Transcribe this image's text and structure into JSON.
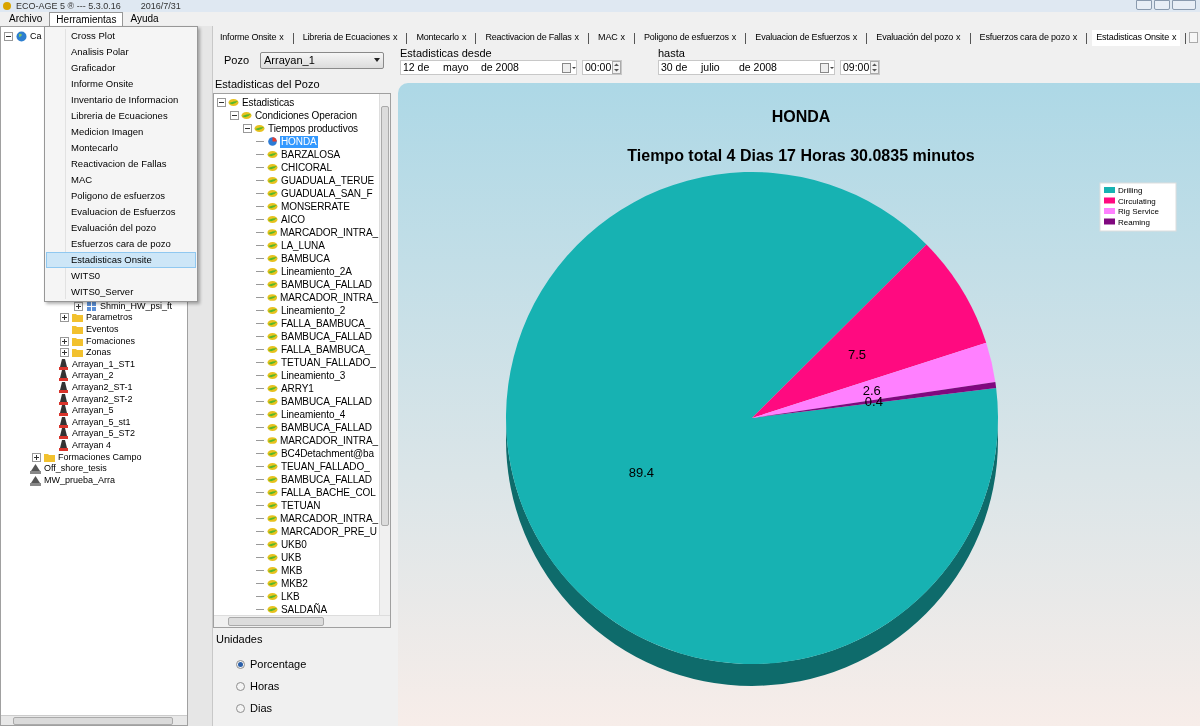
{
  "window": {
    "title": "ECO-AGE 5 ® --- 5.3.0.16",
    "date": "2016/7/31"
  },
  "menu_bar": [
    {
      "label": "Archivo",
      "selected": false
    },
    {
      "label": "Herramientas",
      "selected": true
    },
    {
      "label": "Ayuda",
      "selected": false
    }
  ],
  "open_menu": [
    {
      "label": "Cross Plot",
      "selected": false
    },
    {
      "label": "Analisis Polar",
      "selected": false
    },
    {
      "label": "Graficador",
      "selected": false
    },
    {
      "label": "Informe Onsite",
      "selected": false
    },
    {
      "label": "Inventario de Informacion",
      "selected": false
    },
    {
      "label": "Libreria de Ecuaciones",
      "selected": false
    },
    {
      "label": "Medicion Imagen",
      "selected": false
    },
    {
      "label": "Montecarlo",
      "selected": false
    },
    {
      "label": "Reactivacion de Fallas",
      "selected": false
    },
    {
      "label": "MAC",
      "selected": false
    },
    {
      "label": "Poligono de esfuerzos",
      "selected": false
    },
    {
      "label": "Evaluacion de Esfuerzos",
      "selected": false
    },
    {
      "label": "Evaluación del pozo",
      "selected": false
    },
    {
      "label": "Esfuerzos cara de pozo",
      "selected": false
    },
    {
      "label": "Estadisticas Onsite",
      "selected": true
    },
    {
      "label": "WITS0",
      "selected": false
    },
    {
      "label": "WITS0_Server",
      "selected": false
    }
  ],
  "explorer": {
    "label": "Ca",
    "kind": "globe",
    "expanded": true,
    "children": [
      {
        "children": [
          {
            "children": [
              {
                "children": [
                  {
                    "children": [
                      {
                        "label": "Shmin_HW_psi_ft",
                        "kind": "grid",
                        "expanded": false
                      }
                    ]
                  },
                  {
                    "label": "Parametros",
                    "kind": "folder",
                    "expanded": false
                  },
                  {
                    "label": "Eventos",
                    "kind": "folder"
                  },
                  {
                    "label": "Fomaciones",
                    "kind": "folder",
                    "expanded": false
                  },
                  {
                    "label": "Zonas",
                    "kind": "folder",
                    "expanded": false
                  }
                ]
              },
              {
                "label": "Arrayan_1_ST1",
                "kind": "rig"
              },
              {
                "label": "Arrayan_2",
                "kind": "rig"
              },
              {
                "label": "Arrayan2_ST-1",
                "kind": "rig"
              },
              {
                "label": "Arrayan2_ST-2",
                "kind": "rig"
              },
              {
                "label": "Arrayan_5",
                "kind": "rig"
              },
              {
                "label": "Arrayan_5_st1",
                "kind": "rig"
              },
              {
                "label": "Arrayan_5_ST2",
                "kind": "rig"
              },
              {
                "label": "Arrayan 4",
                "kind": "rig"
              }
            ]
          },
          {
            "label": "Formaciones Campo",
            "kind": "folder",
            "expanded": false
          }
        ]
      },
      {
        "label": "Off_shore_tesis",
        "kind": "platform"
      },
      {
        "label": "MW_prueba_Arra",
        "kind": "platform"
      }
    ]
  },
  "tabs": [
    {
      "label": "Informe Onsite",
      "close": "x",
      "selected": false
    },
    {
      "label": "Libreria de Ecuaciones",
      "close": "x",
      "selected": false
    },
    {
      "label": "Montecarlo",
      "close": "x",
      "selected": false
    },
    {
      "label": "Reactivacion de Fallas",
      "close": "x",
      "selected": false
    },
    {
      "label": "MAC",
      "close": "x",
      "selected": false
    },
    {
      "label": "Poligono de esfuerzos",
      "close": "x",
      "selected": false
    },
    {
      "label": "Evaluacion de Esfuerzos",
      "close": "x",
      "selected": false
    },
    {
      "label": "Evaluación del pozo",
      "close": "x",
      "selected": false
    },
    {
      "label": "Esfuerzos cara de pozo",
      "close": "x",
      "selected": false
    },
    {
      "label": "Estadisticas Onsite",
      "close": "x",
      "selected": true
    }
  ],
  "pozo": {
    "label": "Pozo",
    "value": "Arrayan_1"
  },
  "range": [
    {
      "label": "Estadisticas desde",
      "day": "12 de",
      "month": "mayo",
      "year": "de 2008",
      "time": "00:00"
    },
    {
      "label": "hasta",
      "day": "30 de",
      "month": "julio",
      "year": "de 2008",
      "time": "09:00"
    }
  ],
  "stats_tree": {
    "title": "Estadisticas del Pozo",
    "root": {
      "label": "Estadisticas",
      "expanded": true,
      "children": [
        {
          "label": "Condiciones Operacion",
          "expanded": true,
          "children": [
            {
              "label": "Tiempos productivos",
              "expanded": true,
              "children": [
                {
                  "label": "HONDA",
                  "kind": "chart",
                  "selected": true
                },
                {
                  "label": "BARZALOSA",
                  "selected": false
                },
                {
                  "label": "CHICORAL",
                  "selected": false
                },
                {
                  "label": "GUADUALA_TERUE",
                  "selected": false
                },
                {
                  "label": "GUADUALA_SAN_F",
                  "selected": false
                },
                {
                  "label": "MONSERRATE",
                  "selected": false
                },
                {
                  "label": "AICO",
                  "selected": false
                },
                {
                  "label": "MARCADOR_INTRA_",
                  "selected": false
                },
                {
                  "label": "LA_LUNA",
                  "selected": false
                },
                {
                  "label": "BAMBUCA",
                  "selected": false
                },
                {
                  "label": "Lineamiento_2A",
                  "selected": false
                },
                {
                  "label": "BAMBUCA_FALLAD",
                  "selected": false
                },
                {
                  "label": "MARCADOR_INTRA_",
                  "selected": false
                },
                {
                  "label": "Lineamiento_2",
                  "selected": false
                },
                {
                  "label": "FALLA_BAMBUCA_",
                  "selected": false
                },
                {
                  "label": "BAMBUCA_FALLAD",
                  "selected": false
                },
                {
                  "label": "FALLA_BAMBUCA_",
                  "selected": false
                },
                {
                  "label": "TETUAN_FALLADO_",
                  "selected": false
                },
                {
                  "label": "Lineamiento_3",
                  "selected": false
                },
                {
                  "label": "ARRY1",
                  "selected": false
                },
                {
                  "label": "BAMBUCA_FALLAD",
                  "selected": false
                },
                {
                  "label": "Lineamiento_4",
                  "selected": false
                },
                {
                  "label": "BAMBUCA_FALLAD",
                  "selected": false
                },
                {
                  "label": "MARCADOR_INTRA_",
                  "selected": false
                },
                {
                  "label": "BC4Detachment@ba",
                  "selected": false
                },
                {
                  "label": "TEUAN_FALLADO_",
                  "selected": false
                },
                {
                  "label": "BAMBUCA_FALLAD",
                  "selected": false
                },
                {
                  "label": "FALLA_BACHE_COL",
                  "selected": false
                },
                {
                  "label": "TETUAN",
                  "selected": false
                },
                {
                  "label": "MARCADOR_INTRA_",
                  "selected": false
                },
                {
                  "label": "MARCADOR_PRE_U",
                  "selected": false
                },
                {
                  "label": "UKB0",
                  "selected": false
                },
                {
                  "label": "UKB",
                  "selected": false
                },
                {
                  "label": "MKB",
                  "selected": false
                },
                {
                  "label": "MKB2",
                  "selected": false
                },
                {
                  "label": "LKB",
                  "selected": false
                },
                {
                  "label": "SALDAÑA",
                  "selected": false
                }
              ]
            }
          ]
        }
      ]
    }
  },
  "units": {
    "title": "Unidades",
    "options": [
      {
        "label": "Porcentage",
        "selected": true
      },
      {
        "label": "Horas",
        "selected": false
      },
      {
        "label": "Dias",
        "selected": false
      }
    ]
  },
  "chart_panel": {
    "subtitle": "Tiempo total 4 Dias 17 Horas 30.0835 minutos",
    "chart_data": {
      "type": "pie",
      "title": "HONDA",
      "categories": [
        "Drilling",
        "Circulating",
        "Rig Service",
        "Reaming"
      ],
      "values": [
        89.4,
        7.5,
        2.6,
        0.4
      ],
      "colors": [
        "#17b2b2",
        "#ff0a80",
        "#ff80ff",
        "#80087f"
      ],
      "data_labels": true,
      "legend": "right"
    }
  }
}
